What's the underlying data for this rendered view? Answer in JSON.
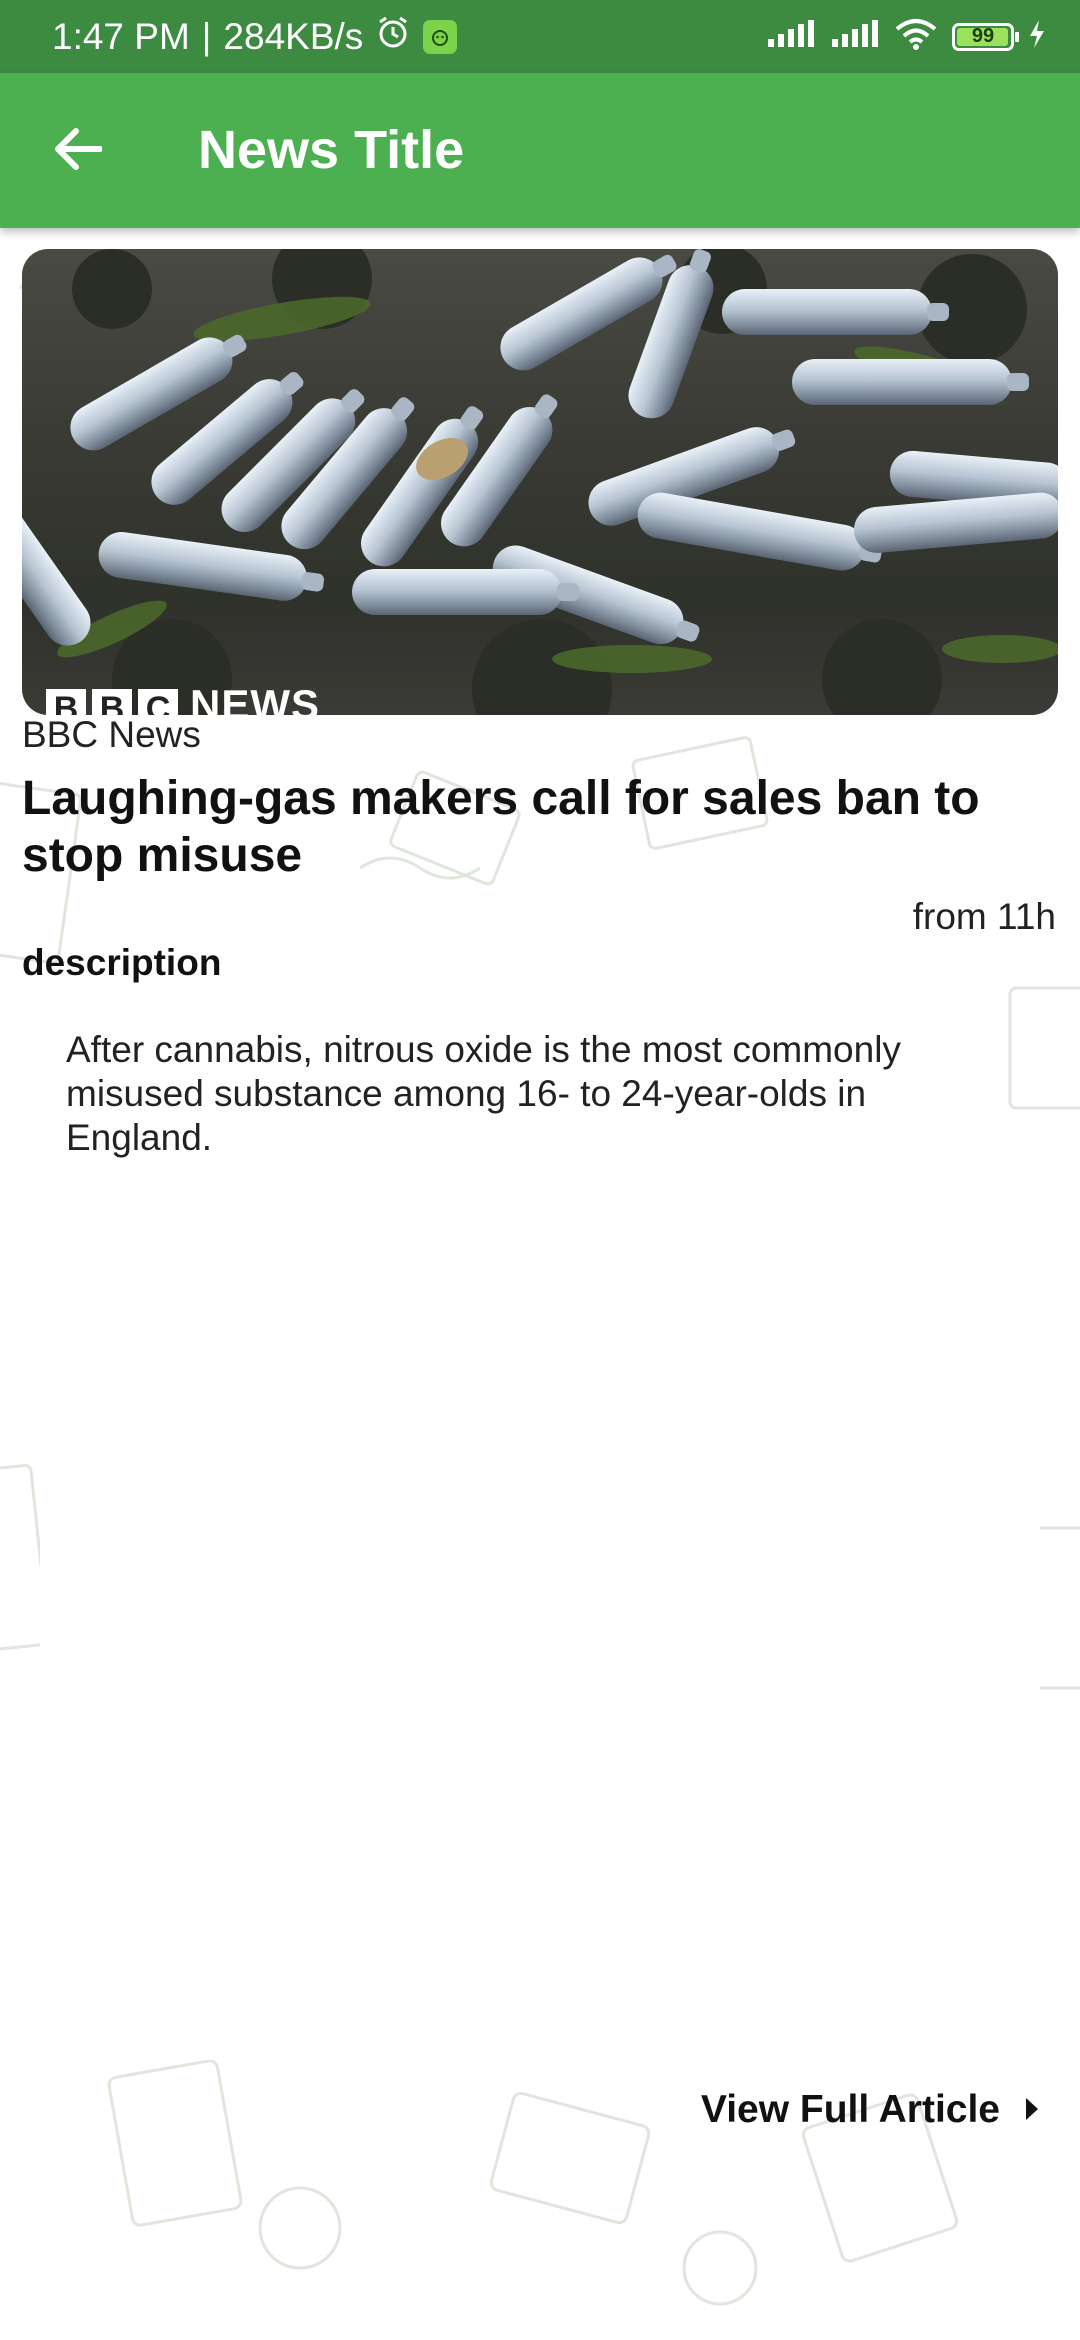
{
  "status_bar": {
    "time": "1:47 PM",
    "separator": "|",
    "speed": "284KB/s",
    "battery": "99"
  },
  "app_bar": {
    "title": "News Title",
    "accent_color": "#4caf50"
  },
  "article": {
    "image_logo_letters": [
      "B",
      "B",
      "C"
    ],
    "image_logo_word": "NEWS",
    "source": "BBC News",
    "headline": "Laughing-gas makers call for sales ban to stop misuse",
    "time": "from 11h",
    "description_label": "description",
    "description": "After cannabis, nitrous oxide is the most commonly misused substance among 16- to 24-year-olds in England."
  },
  "actions": {
    "view_full": "View Full Article"
  },
  "icons": {
    "back": "arrow-left-icon",
    "alarm": "alarm-icon",
    "app_badge": "app-badge-icon",
    "signal": "signal-icon",
    "wifi": "wifi-icon",
    "battery": "battery-icon",
    "charging": "charging-icon",
    "chevron": "chevron-right-icon"
  }
}
